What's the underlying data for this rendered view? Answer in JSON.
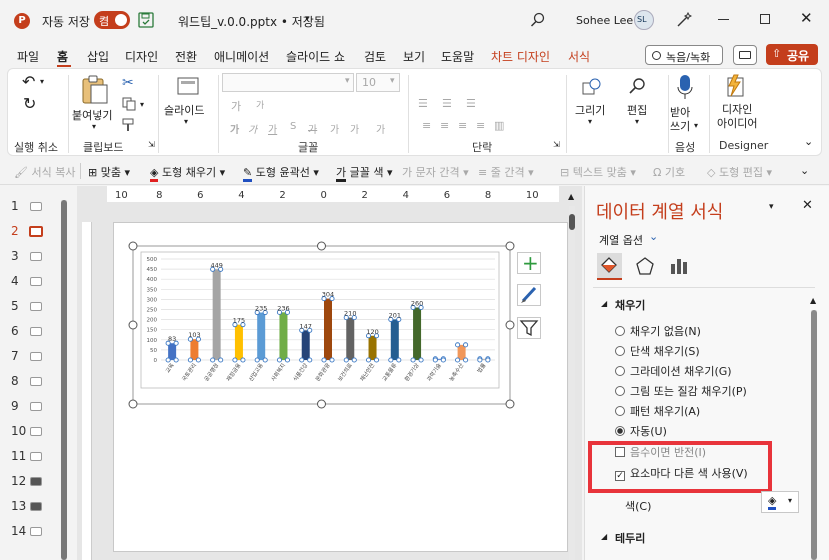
{
  "titlebar": {
    "autosave_label": "자동 저장",
    "autosave_state": "켬",
    "file_name": "워드팁_v.0.0.pptx • 저장됨 ",
    "user_name": "Sohee Lee",
    "user_initials": "SL"
  },
  "menu": {
    "tabs": [
      "파일",
      "홈",
      "삽입",
      "디자인",
      "전환",
      "애니메이션",
      "슬라이드 쇼",
      "검토",
      "보기",
      "도움말",
      "차트 디자인",
      "서식"
    ],
    "record_label": "녹음/녹화",
    "share_label": "공유"
  },
  "ribbon": {
    "undo_group": "실행 취소",
    "paste_label": "붙여넣기",
    "clipboard_group": "클립보드",
    "slide_label": "슬라이드",
    "font_size": "10",
    "font_group": "글꼴",
    "paragraph_group": "단락",
    "drawing_label": "그리기",
    "edit_label": "편집",
    "dictate_label": "받아\n쓰기",
    "voice_group": "음성",
    "designer_label": "디자인\n아이디어",
    "designer_group": "Designer"
  },
  "qatoolbar": {
    "format_copy": "서식 복사",
    "align": "맞춤",
    "shape_fill": "도형 채우기",
    "shape_outline": "도형 윤곽선",
    "font_color": "글꼴 색",
    "char_spacing": "문자 간격",
    "line_spacing": "줄 간격",
    "text_align": "텍스트 맞춤",
    "symbol": "기호",
    "shape_edit": "도형 편집"
  },
  "slides": [
    "1",
    "2",
    "3",
    "4",
    "5",
    "6",
    "7",
    "8",
    "9",
    "10",
    "11",
    "12",
    "13",
    "14"
  ],
  "ruler": {
    "labels": [
      "10",
      "8",
      "6",
      "4",
      "2",
      "0",
      "2",
      "4",
      "6",
      "8",
      "10"
    ]
  },
  "format_pane": {
    "title": "데이터 계열 서식",
    "series_options": "계열 옵션",
    "fill_section": "채우기",
    "options": [
      {
        "label": "채우기 없음(N)",
        "selected": false
      },
      {
        "label": "단색 채우기(S)",
        "selected": false
      },
      {
        "label": "그라데이션 채우기(G)",
        "selected": false
      },
      {
        "label": "그림 또는 질감 채우기(P)",
        "selected": false
      },
      {
        "label": "패턴 채우기(A)",
        "selected": false
      },
      {
        "label": "자동(U)",
        "selected": true
      }
    ],
    "invert_label": "음수이면 반전(I)",
    "vary_colors_label": "요소마다 다른 색 사용(V)",
    "color_label": "색(C)",
    "border_section": "테두리"
  },
  "colors": {
    "accent": "#c43e1c",
    "highlight": "#e8343b"
  },
  "chart_data": {
    "type": "bar",
    "categories": [
      "교육",
      "국토관리",
      "공공행정",
      "재정금융",
      "산업고용",
      "사회복지",
      "식품건강",
      "문화관광",
      "보건의료",
      "재난안전",
      "교통물류",
      "환경기상",
      "과학기술",
      "농축수산",
      "법률"
    ],
    "values": [
      83,
      103,
      449,
      175,
      235,
      236,
      147,
      304,
      210,
      120,
      201,
      260,
      6,
      75,
      6
    ],
    "data_labels": [
      "83",
      "103",
      "449",
      "175",
      "235",
      "236",
      "147",
      "304",
      "210",
      "120",
      "201",
      "260",
      "",
      "",
      ""
    ],
    "colors": [
      "#4472c4",
      "#ed7d31",
      "#a5a5a5",
      "#ffc000",
      "#5b9bd5",
      "#70ad47",
      "#264478",
      "#9e480e",
      "#636363",
      "#997300",
      "#255e91",
      "#43682b",
      "#698ed0",
      "#f1975a",
      "#b7b7b7"
    ],
    "y_ticks": [
      "0",
      "50",
      "100",
      "150",
      "200",
      "250",
      "300",
      "350",
      "400",
      "450",
      "500"
    ],
    "ylim": [
      0,
      500
    ],
    "grid": true
  }
}
